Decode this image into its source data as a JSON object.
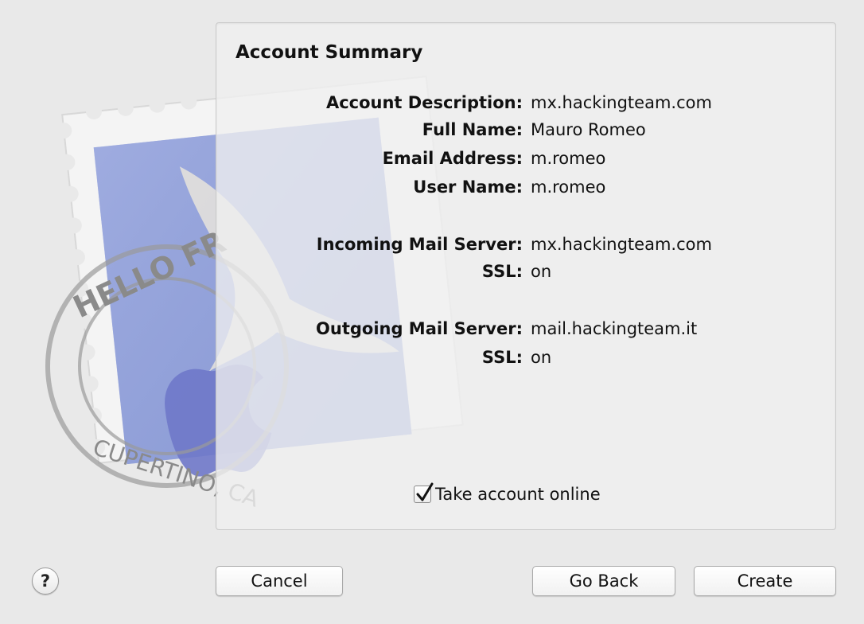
{
  "panel": {
    "title": "Account Summary"
  },
  "summary": {
    "account_description": {
      "label": "Account Description:",
      "value": "mx.hackingteam.com"
    },
    "full_name": {
      "label": "Full Name:",
      "value": "Mauro Romeo"
    },
    "email_address": {
      "label": "Email Address:",
      "value": "m.romeo"
    },
    "user_name": {
      "label": "User Name:",
      "value": "m.romeo"
    },
    "incoming_server": {
      "label": "Incoming Mail Server:",
      "value": "mx.hackingteam.com"
    },
    "incoming_ssl": {
      "label": "SSL:",
      "value": "on"
    },
    "outgoing_server": {
      "label": "Outgoing Mail Server:",
      "value": "mail.hackingteam.it"
    },
    "outgoing_ssl": {
      "label": "SSL:",
      "value": "on"
    }
  },
  "online_checkbox": {
    "label": "Take account online",
    "checked": true
  },
  "stamp": {
    "postmark_top": "HELLO FR",
    "postmark_bottom": "CUPERTINO, CA"
  },
  "buttons": {
    "help": "?",
    "cancel": "Cancel",
    "go_back": "Go Back",
    "create": "Create"
  },
  "icons": {
    "stamp": "mail-stamp-icon",
    "check": "checkmark-icon"
  }
}
